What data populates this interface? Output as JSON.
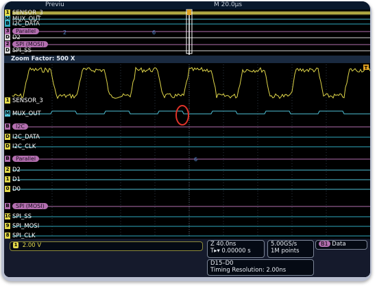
{
  "header": {
    "preview_label": "Previu",
    "timebase_label": "M 20.0µs"
  },
  "overview": {
    "channels": [
      {
        "chip": "1",
        "name": "SENSOR_3",
        "color": "#e2d84a"
      },
      {
        "chip": "M",
        "name": "MUX_OUT",
        "color": "#4fc2d8"
      },
      {
        "chip": "B",
        "name": "I2C_DATA",
        "color": "#2faabf"
      },
      {
        "chip": "3",
        "name": "Parallel",
        "color": "#b46fb0"
      },
      {
        "chip": "D",
        "name": "D2",
        "color": "#d8d8d8"
      },
      {
        "chip": "2",
        "name": "SPI (MOSI)",
        "color": "#b46fb0"
      },
      {
        "chip": "D",
        "name": "SPI_SS",
        "color": "#d8d8d8"
      }
    ],
    "parallel_values": [
      "2",
      "6"
    ]
  },
  "zoom": {
    "label": "Zoom Factor: 500 X",
    "parallel_value": "6"
  },
  "channels": [
    {
      "chip": "1",
      "chip_color": "#e2d84a",
      "label": "SENSOR_3",
      "color": "#e2d84a"
    },
    {
      "chip": "M",
      "chip_color": "#4fc2d8",
      "label": "MUX_OUT",
      "color": "#4fc2d8"
    },
    {
      "chip": "B",
      "chip_color": "#b46fb0",
      "label": "I2C",
      "color": "#b46fb0",
      "is_bus": true
    },
    {
      "chip": "D",
      "chip_color": "#e2d84a",
      "label": "I2C_DATA",
      "color": "#2faabf"
    },
    {
      "chip": "D",
      "chip_color": "#e2d84a",
      "label": "I2C_CLK",
      "color": "#2faabf"
    },
    {
      "chip": "B",
      "chip_color": "#b46fb0",
      "label": "Parallel",
      "color": "#b46fb0",
      "is_bus": true
    },
    {
      "chip": "2",
      "chip_color": "#e2d84a",
      "label": "D2",
      "color": "#4fc2d8"
    },
    {
      "chip": "1",
      "chip_color": "#e2d84a",
      "label": "D1",
      "color": "#4fc2d8"
    },
    {
      "chip": "0",
      "chip_color": "#e2d84a",
      "label": "D0",
      "color": "#4fc2d8"
    },
    {
      "chip": "B",
      "chip_color": "#b46fb0",
      "label": "SPI (MOSI)",
      "color": "#b46fb0",
      "is_bus": true
    },
    {
      "chip": "10",
      "chip_color": "#e2d84a",
      "label": "SPI_SS",
      "color": "#2faabf"
    },
    {
      "chip": "9",
      "chip_color": "#e2d84a",
      "label": "SPI_MOSI",
      "color": "#2faabf"
    },
    {
      "chip": "8",
      "chip_color": "#e2d84a",
      "label": "SPI_CLK",
      "color": "#2faabf"
    }
  ],
  "readout": {
    "ch1_chip": "1",
    "ch1_scale": "2.00 V",
    "horizontal": {
      "scale": "Z 40.0ns",
      "delay": "T▸▾ 0.00000 s"
    },
    "sample": {
      "rate": "5.00GS/s",
      "points": "1M points"
    },
    "bus": {
      "chip": "B1",
      "label": "Data"
    },
    "digital": {
      "channels": "D15–D0",
      "resolution": "Timing Resolution: 2.00ns"
    }
  },
  "trigger_marker": "T",
  "colors": {
    "analog": "#e2d84a",
    "digital": "#2faabf",
    "bus": "#b46fb0",
    "highlight": "#e0332a"
  }
}
